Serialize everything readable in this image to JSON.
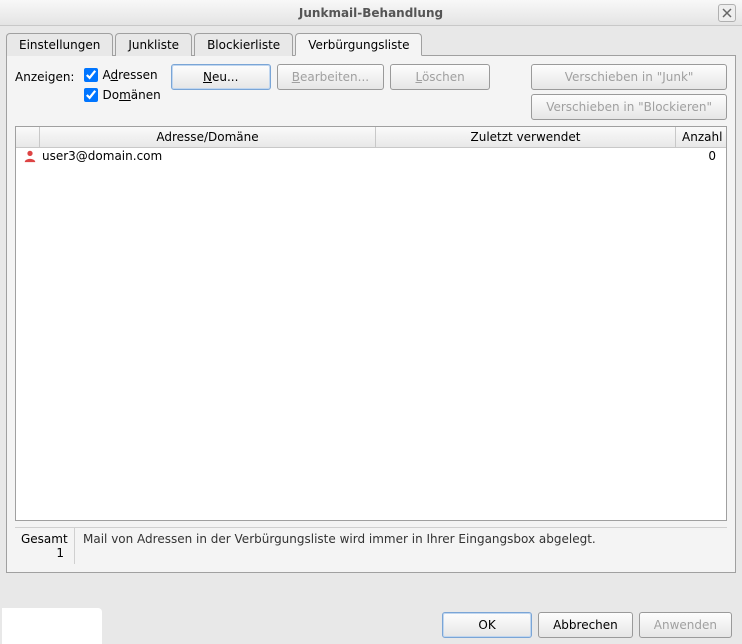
{
  "window": {
    "title": "Junkmail-Behandlung"
  },
  "tabs": [
    {
      "label": "Einstellungen",
      "active": false
    },
    {
      "label": "Junkliste",
      "active": false
    },
    {
      "label": "Blockierliste",
      "active": false
    },
    {
      "label": "Verbürgungsliste",
      "active": true
    }
  ],
  "show": {
    "label": "Anzeigen:",
    "addresses_prefix": "A",
    "addresses_u": "d",
    "addresses_suffix": "ressen",
    "addresses_checked": true,
    "domains_prefix": "Do",
    "domains_u": "m",
    "domains_suffix": "änen",
    "domains_checked": true
  },
  "buttons": {
    "new_u": "N",
    "new_suffix": "eu...",
    "edit_u": "B",
    "edit_suffix": "earbeiten...",
    "delete_u": "L",
    "delete_suffix": "öschen",
    "move_junk": "Verschieben in \"Junk\"",
    "move_block": "Verschieben in \"Blockieren\""
  },
  "table": {
    "headers": {
      "address": "Adresse/Domäne",
      "last": "Zuletzt verwendet",
      "count": "Anzahl"
    },
    "rows": [
      {
        "address": "user3@domain.com",
        "last": "",
        "count": "0"
      }
    ]
  },
  "footer": {
    "total_label": "Gesamt",
    "total_value": "1",
    "message": "Mail von Adressen in der Verbürgungsliste wird immer in Ihrer Eingangsbox abgelegt."
  },
  "dialog": {
    "ok": "OK",
    "cancel": "Abbrechen",
    "apply": "Anwenden"
  }
}
